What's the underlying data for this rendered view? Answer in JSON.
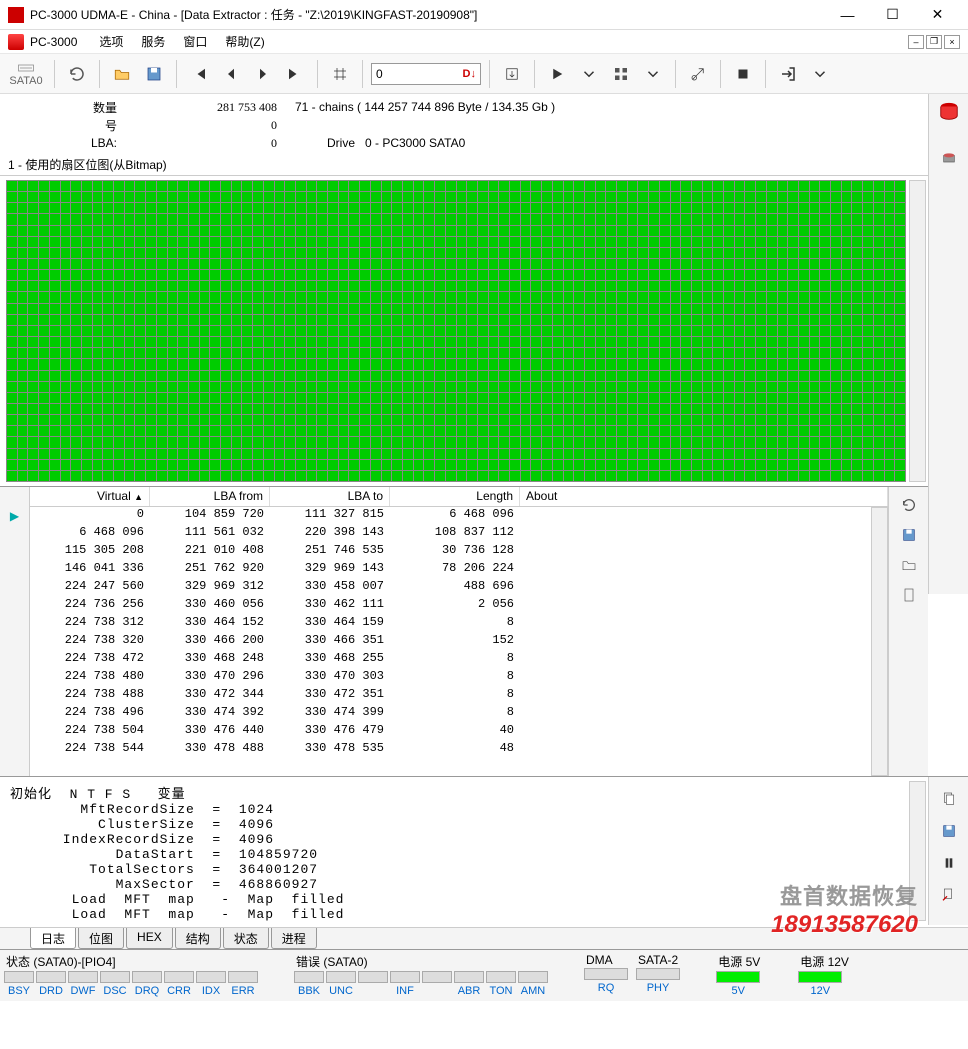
{
  "window": {
    "title": "PC-3000 UDMA-E - China - [Data Extractor : 任务 - \"Z:\\2019\\KINGFAST-20190908\"]"
  },
  "menu": {
    "brand": "PC-3000",
    "items": [
      "选项",
      "服务",
      "窗口",
      "帮助(Z)"
    ]
  },
  "toolbar": {
    "sata_label": "SATA0",
    "numfield_value": "0",
    "numfield_suffix": "D↓"
  },
  "info": {
    "row1_label": "数量",
    "row1_val": "281 753 408",
    "row1_extra": "71 - chains  ( 144 257 744 896 Byte /   134.35 Gb )",
    "row2_label": "号",
    "row2_val": "0",
    "row3_label": "LBA:",
    "row3_val": "0",
    "row3_label2": "Drive",
    "row3_val2": "0 - PC3000 SATA0"
  },
  "bitmap_title": "1 - 使用的扇区位图(从Bitmap)",
  "table": {
    "headers": {
      "virtual": "Virtual",
      "lba_from": "LBA from",
      "lba_to": "LBA to",
      "length": "Length",
      "about": "About"
    },
    "rows": [
      {
        "v": "0",
        "lf": "104 859 720",
        "lt": "111 327 815",
        "len": "6 468 096"
      },
      {
        "v": "6 468 096",
        "lf": "111 561 032",
        "lt": "220 398 143",
        "len": "108 837 112"
      },
      {
        "v": "115 305 208",
        "lf": "221 010 408",
        "lt": "251 746 535",
        "len": "30 736 128"
      },
      {
        "v": "146 041 336",
        "lf": "251 762 920",
        "lt": "329 969 143",
        "len": "78 206 224"
      },
      {
        "v": "224 247 560",
        "lf": "329 969 312",
        "lt": "330 458 007",
        "len": "488 696"
      },
      {
        "v": "224 736 256",
        "lf": "330 460 056",
        "lt": "330 462 111",
        "len": "2 056"
      },
      {
        "v": "224 738 312",
        "lf": "330 464 152",
        "lt": "330 464 159",
        "len": "8"
      },
      {
        "v": "224 738 320",
        "lf": "330 466 200",
        "lt": "330 466 351",
        "len": "152"
      },
      {
        "v": "224 738 472",
        "lf": "330 468 248",
        "lt": "330 468 255",
        "len": "8"
      },
      {
        "v": "224 738 480",
        "lf": "330 470 296",
        "lt": "330 470 303",
        "len": "8"
      },
      {
        "v": "224 738 488",
        "lf": "330 472 344",
        "lt": "330 472 351",
        "len": "8"
      },
      {
        "v": "224 738 496",
        "lf": "330 474 392",
        "lt": "330 474 399",
        "len": "8"
      },
      {
        "v": "224 738 504",
        "lf": "330 476 440",
        "lt": "330 476 479",
        "len": "40"
      },
      {
        "v": "224 738 544",
        "lf": "330 478 488",
        "lt": "330 478 535",
        "len": "48"
      }
    ]
  },
  "log_lines": [
    "初始化  N T F S   变量",
    "        MftRecordSize  =  1024",
    "          ClusterSize  =  4096",
    "      IndexRecordSize  =  4096",
    "            DataStart  =  104859720",
    "         TotalSectors  =  364001207",
    "            MaxSector  =  468860927",
    "       Load  MFT  map   -  Map  filled",
    "       Load  MFT  map   -  Map  filled"
  ],
  "tabs": [
    "日志",
    "位图",
    "HEX",
    "结构",
    "状态",
    "进程"
  ],
  "status": {
    "group1_title": "状态 (SATA0)-[PIO4]",
    "group1": [
      "BSY",
      "DRD",
      "DWF",
      "DSC",
      "DRQ",
      "CRR",
      "IDX",
      "ERR"
    ],
    "group2_title": "错误 (SATA0)",
    "group2": [
      "BBK",
      "UNC",
      "",
      "INF",
      "",
      "ABR",
      "TON",
      "AMN"
    ],
    "dma_title": "DMA",
    "dma": [
      "RQ"
    ],
    "sata2_title": "SATA-2",
    "sata2": [
      "PHY"
    ],
    "p5v_title": "电源 5V",
    "p5v": [
      "5V"
    ],
    "p12v_title": "电源 12V",
    "p12v": [
      "12V"
    ]
  },
  "watermark": {
    "line1": "盘首数据恢复",
    "line2": "18913587620"
  }
}
